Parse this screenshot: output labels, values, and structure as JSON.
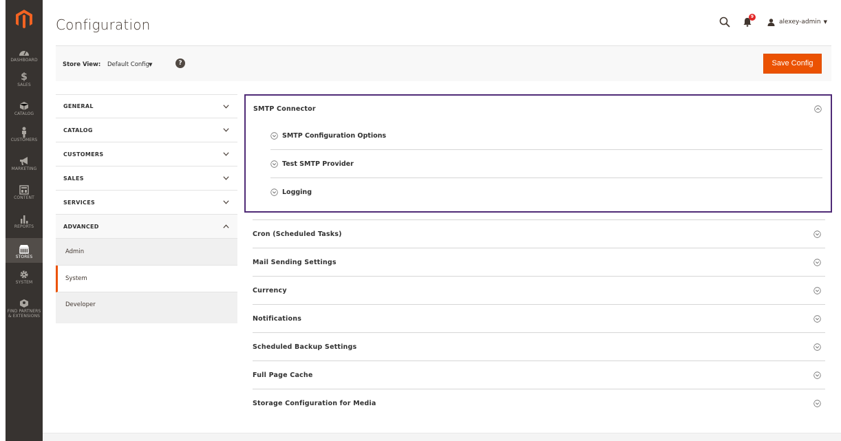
{
  "rail": {
    "items": [
      {
        "label": "DASHBOARD",
        "icon": "dashboard-icon"
      },
      {
        "label": "SALES",
        "icon": "dollar-icon"
      },
      {
        "label": "CATALOG",
        "icon": "box-icon"
      },
      {
        "label": "CUSTOMERS",
        "icon": "person-icon"
      },
      {
        "label": "MARKETING",
        "icon": "megaphone-icon"
      },
      {
        "label": "CONTENT",
        "icon": "layout-icon"
      },
      {
        "label": "REPORTS",
        "icon": "bar-chart-icon"
      },
      {
        "label": "STORES",
        "icon": "store-icon"
      },
      {
        "label": "SYSTEM",
        "icon": "gear-icon"
      },
      {
        "label": "FIND PARTNERS & EXTENSIONS",
        "icon": "puzzle-icon"
      }
    ]
  },
  "header": {
    "title": "Configuration",
    "notification_count": "9",
    "username": "alexey-admin"
  },
  "store_view": {
    "label": "Store View:",
    "value": "Default Config",
    "help": "?"
  },
  "actions": {
    "save_label": "Save Config"
  },
  "nav": {
    "groups": [
      {
        "label": "GENERAL"
      },
      {
        "label": "CATALOG"
      },
      {
        "label": "CUSTOMERS"
      },
      {
        "label": "SALES"
      },
      {
        "label": "SERVICES"
      },
      {
        "label": "ADVANCED"
      }
    ],
    "advanced_items": [
      {
        "label": "Admin"
      },
      {
        "label": "System"
      },
      {
        "label": "Developer"
      }
    ]
  },
  "content": {
    "smtp": {
      "title": "SMTP Connector",
      "sub_sections": [
        {
          "label": "SMTP Configuration Options"
        },
        {
          "label": "Test SMTP Provider"
        },
        {
          "label": "Logging"
        }
      ]
    },
    "sections": [
      {
        "label": "Cron (Scheduled Tasks)"
      },
      {
        "label": "Mail Sending Settings"
      },
      {
        "label": "Currency"
      },
      {
        "label": "Notifications"
      },
      {
        "label": "Scheduled Backup Settings"
      },
      {
        "label": "Full Page Cache"
      },
      {
        "label": "Storage Configuration for Media"
      }
    ]
  },
  "colors": {
    "accent": "#eb5202",
    "rail": "#373330",
    "highlight_border": "#4f2a76"
  }
}
